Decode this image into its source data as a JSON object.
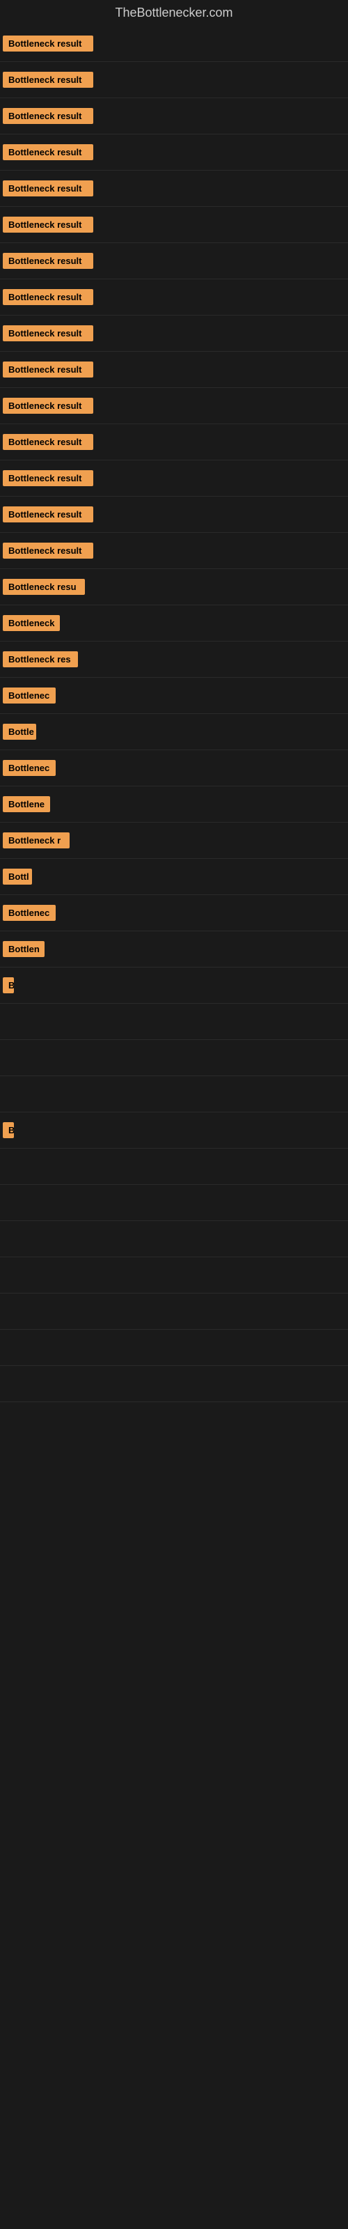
{
  "site": {
    "title": "TheBottlenecker.com"
  },
  "rows": [
    {
      "label": "Bottleneck result",
      "width": "full"
    },
    {
      "label": "Bottleneck result",
      "width": "full"
    },
    {
      "label": "Bottleneck result",
      "width": "full"
    },
    {
      "label": "Bottleneck result",
      "width": "full"
    },
    {
      "label": "Bottleneck result",
      "width": "full"
    },
    {
      "label": "Bottleneck result",
      "width": "full"
    },
    {
      "label": "Bottleneck result",
      "width": "full"
    },
    {
      "label": "Bottleneck result",
      "width": "full"
    },
    {
      "label": "Bottleneck result",
      "width": "full"
    },
    {
      "label": "Bottleneck result",
      "width": "full"
    },
    {
      "label": "Bottleneck result",
      "width": "full"
    },
    {
      "label": "Bottleneck result",
      "width": "full"
    },
    {
      "label": "Bottleneck result",
      "width": "full"
    },
    {
      "label": "Bottleneck result",
      "width": "full"
    },
    {
      "label": "Bottleneck result",
      "width": "full"
    },
    {
      "label": "Bottleneck resu",
      "width": "clipped1"
    },
    {
      "label": "Bottleneck",
      "width": "clipped2"
    },
    {
      "label": "Bottleneck res",
      "width": "clipped3"
    },
    {
      "label": "Bottlenec",
      "width": "clipped4"
    },
    {
      "label": "Bottle",
      "width": "clipped5"
    },
    {
      "label": "Bottlenec",
      "width": "clipped4"
    },
    {
      "label": "Bottlene",
      "width": "clipped6"
    },
    {
      "label": "Bottleneck r",
      "width": "clipped7"
    },
    {
      "label": "Bottl",
      "width": "clipped8"
    },
    {
      "label": "Bottlenec",
      "width": "clipped4"
    },
    {
      "label": "Bottlen",
      "width": "clipped9"
    },
    {
      "label": "B",
      "width": "clipped10"
    },
    {
      "label": "",
      "width": "empty"
    },
    {
      "label": "",
      "width": "empty"
    },
    {
      "label": "",
      "width": "empty"
    },
    {
      "label": "B",
      "width": "clipped10"
    },
    {
      "label": "",
      "width": "empty"
    },
    {
      "label": "",
      "width": "empty"
    },
    {
      "label": "",
      "width": "empty"
    },
    {
      "label": "",
      "width": "empty"
    },
    {
      "label": "",
      "width": "empty"
    },
    {
      "label": "",
      "width": "empty"
    },
    {
      "label": "",
      "width": "empty"
    }
  ],
  "badge_color": "#f0a050"
}
